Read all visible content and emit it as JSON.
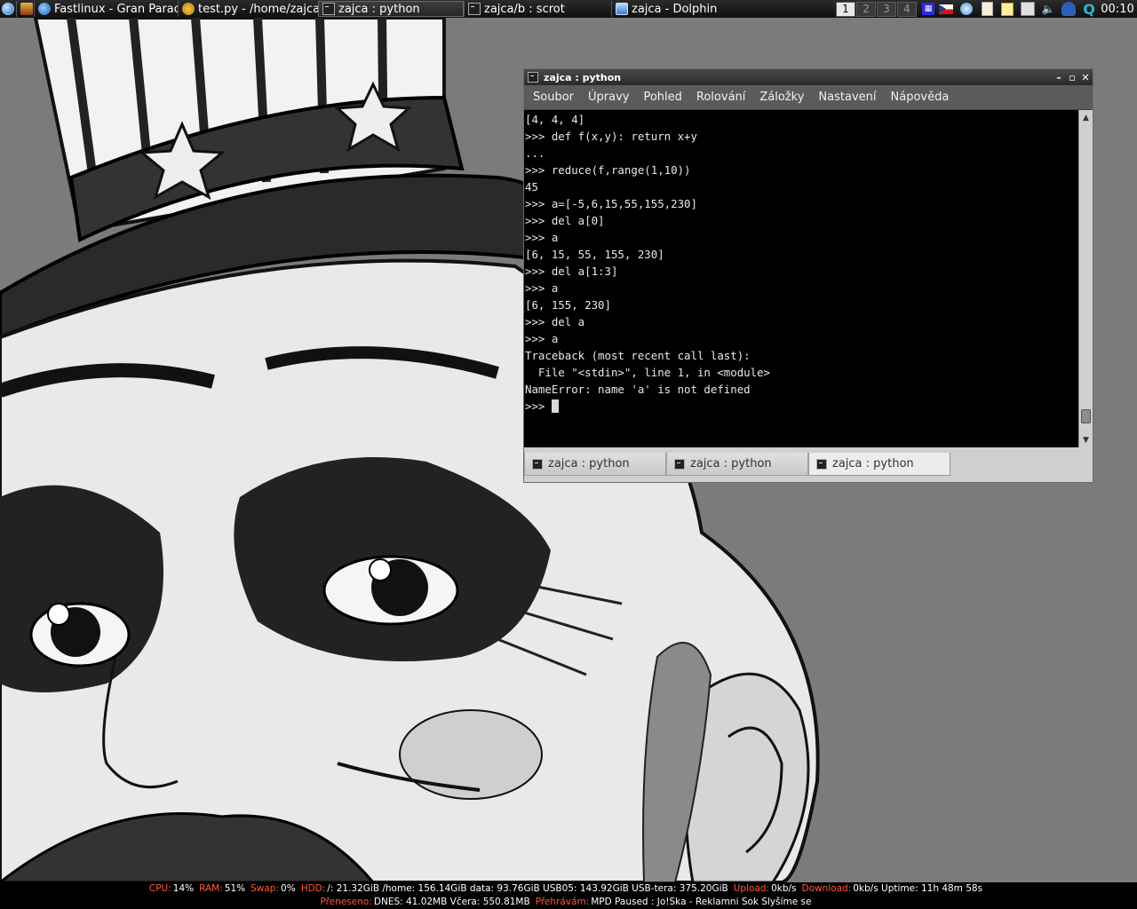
{
  "top_panel": {
    "tasks": [
      {
        "title": "",
        "icon": "tool-icon",
        "width": 20
      },
      {
        "title": "Fastlinux - Gran Paradiso",
        "icon": "globe-icon",
        "width": 162
      },
      {
        "title": "test.py - /home/zajca",
        "icon": "snake-icon",
        "width": 158
      },
      {
        "title": "zajca : python",
        "icon": "terminal-icon",
        "width": 164,
        "active": true
      },
      {
        "title": "zajca/b : scrot",
        "icon": "terminal-icon",
        "width": 166
      },
      {
        "title": "zajca - Dolphin",
        "icon": "dolphin-icon",
        "width": 210
      }
    ],
    "desktops": [
      "1",
      "2",
      "3",
      "4"
    ],
    "current_desktop": "1",
    "clock": "00:10"
  },
  "konsole": {
    "title": "zajca : python",
    "menu": [
      "Soubor",
      "Úpravy",
      "Pohled",
      "Rolování",
      "Záložky",
      "Nastavení",
      "Nápověda"
    ],
    "lines": [
      "[4, 4, 4]",
      ">>> def f(x,y): return x+y",
      "...",
      ">>> reduce(f,range(1,10))",
      "45",
      ">>> a=[-5,6,15,55,155,230]",
      ">>> del a[0]",
      ">>> a",
      "[6, 15, 55, 155, 230]",
      ">>> del a[1:3]",
      ">>> a",
      "[6, 155, 230]",
      ">>> del a",
      ">>> a",
      "Traceback (most recent call last):",
      "  File \"<stdin>\", line 1, in <module>",
      "NameError: name 'a' is not defined"
    ],
    "prompt": ">>> ",
    "tabs": [
      "zajca : python",
      "zajca : python",
      "zajca : python"
    ],
    "active_tab": 2
  },
  "statusbar": {
    "row1": [
      {
        "label": "CPU:",
        "value": "14%"
      },
      {
        "label": "RAM:",
        "value": "51%"
      },
      {
        "label": "Swap:",
        "value": "0%"
      },
      {
        "label": "HDD:",
        "value": "/: 21.32GiB  /home: 156.14GiB  data: 93.76GiB  USB05: 143.92GiB  USB-tera: 375.20GiB"
      },
      {
        "label": "Upload:",
        "value": "0kb/s"
      },
      {
        "label": "Download:",
        "value": "0kb/s  Uptime: 11h 48m 58s"
      }
    ],
    "row2": [
      {
        "label": "Přeneseno:",
        "value": "DNES: 41.02MB  Včera: 550.81MB"
      },
      {
        "label": "Přehrávám:",
        "value": "MPD  Paused :   Jo!Ska - Reklamni Sok Slyšíme se"
      }
    ]
  },
  "colors": {
    "label": "#ff5a33",
    "panel": "#1a1a1a",
    "terminal_bg": "#000000",
    "terminal_fg": "#e8e8e8"
  }
}
